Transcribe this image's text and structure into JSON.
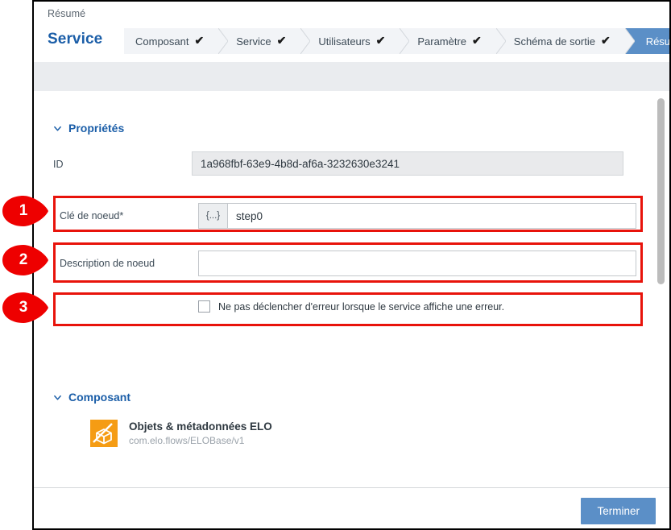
{
  "window": {
    "breadcrumb": "Résumé",
    "title": "Service",
    "close_label": "close-icon"
  },
  "wizard": {
    "steps": [
      {
        "label": "Composant",
        "completed": true,
        "active": false
      },
      {
        "label": "Service",
        "completed": true,
        "active": false
      },
      {
        "label": "Utilisateurs",
        "completed": true,
        "active": false
      },
      {
        "label": "Paramètre",
        "completed": true,
        "active": false
      },
      {
        "label": "Schéma de sortie",
        "completed": true,
        "active": false
      },
      {
        "label": "Résumé",
        "completed": false,
        "active": true
      }
    ],
    "check_glyph": "✔"
  },
  "sections": {
    "properties": {
      "heading": "Propriétés",
      "caret": "chevron-down-icon",
      "fields": {
        "id": {
          "label": "ID",
          "value": "1a968fbf-63e9-4b8d-af6a-3232630e3241",
          "readonly": true
        },
        "node_key": {
          "label": "Clé de noeud*",
          "value": "step0",
          "placeholder": "",
          "prefix_button": "{...}"
        },
        "node_description": {
          "label": "Description de noeud",
          "value": "",
          "placeholder": ""
        },
        "suppress_error": {
          "label": "Ne pas déclencher d'erreur lorsque le service affiche une erreur.",
          "checked": false
        }
      }
    },
    "component": {
      "heading": "Composant",
      "caret": "chevron-down-icon",
      "item": {
        "name": "Objets & métadonnées ELO",
        "identifier": "com.elo.flows/ELOBase/v1",
        "icon": "elo-cube-icon"
      }
    }
  },
  "footer": {
    "primary_button": "Terminer"
  },
  "annotations": [
    {
      "number": "1",
      "target": "node-key-row"
    },
    {
      "number": "2",
      "target": "node-description-row"
    },
    {
      "number": "3",
      "target": "suppress-error-row"
    }
  ],
  "colors": {
    "accent_blue": "#1b5ea8",
    "button_blue": "#5b8fc7",
    "step_bg": "#f2f4f7",
    "highlight_red": "#e8130b",
    "component_orange": "#f59c14",
    "strip_gray": "#eaecef"
  }
}
